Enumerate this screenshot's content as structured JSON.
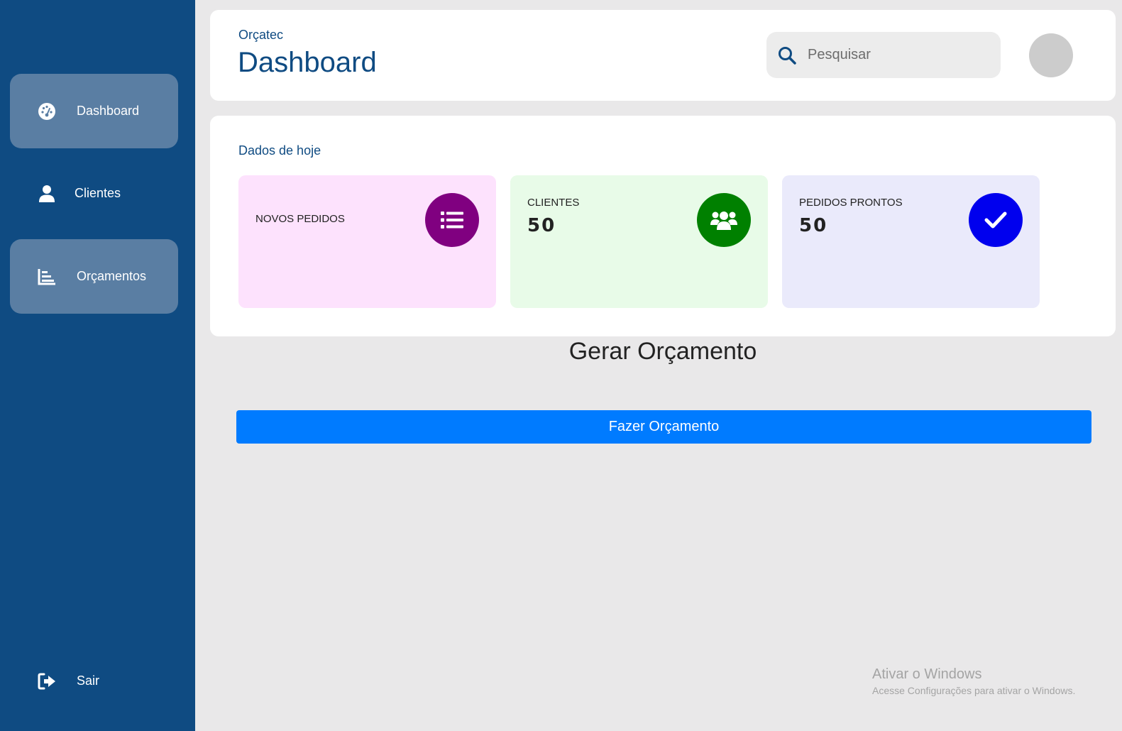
{
  "sidebar": {
    "items": [
      {
        "label": "Dashboard",
        "icon": "tachometer-icon",
        "active": true
      },
      {
        "label": "Clientes",
        "icon": "user-icon",
        "active": false
      },
      {
        "label": "Orçamentos",
        "icon": "chart-bar-icon",
        "active": true
      }
    ],
    "logout": {
      "label": "Sair",
      "icon": "sign-out-icon"
    }
  },
  "header": {
    "brand": "Orçatec",
    "title": "Dashboard",
    "search": {
      "placeholder": "Pesquisar",
      "value": "",
      "icon": "search-icon"
    },
    "avatar": "avatar"
  },
  "stats": {
    "title": "Dados de hoje",
    "cards": [
      {
        "label": "NOVOS PEDIDOS",
        "value": "",
        "icon": "list-icon",
        "color": "#800080",
        "background": "#fde2fd"
      },
      {
        "label": "CLIENTES",
        "value": "50",
        "icon": "users-icon",
        "color": "#008000",
        "background": "#e8fbe8"
      },
      {
        "label": "PEDIDOS PRONTOS",
        "value": "50",
        "icon": "check-icon",
        "color": "#0000ee",
        "background": "#eaeafb"
      }
    ]
  },
  "quote": {
    "title": "Gerar Orçamento",
    "button_label": "Fazer Orçamento"
  },
  "watermark": {
    "title": "Ativar o Windows",
    "subtitle": "Acesse Configurações para ativar o Windows."
  },
  "colors": {
    "sidebar": "#0f4b82",
    "active_item": "#5a7ea3",
    "accent_text": "#0f4b82",
    "primary_button": "#007bff",
    "page_background": "#e9e8e9"
  }
}
